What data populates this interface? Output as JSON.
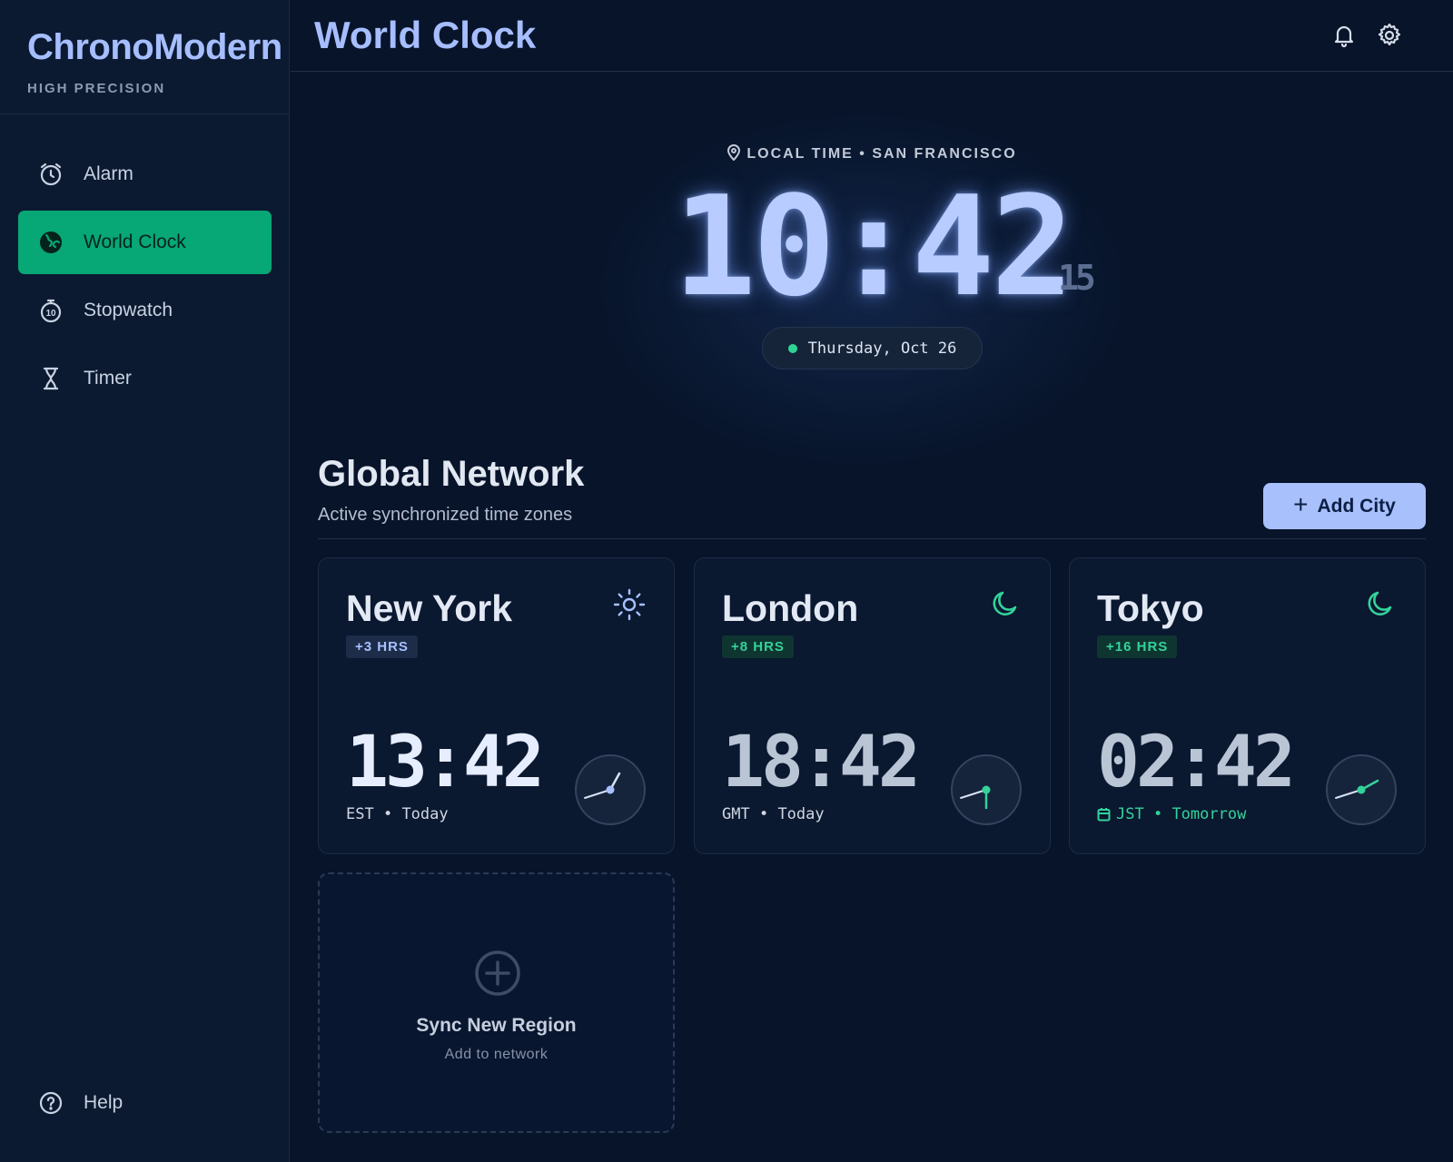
{
  "brand": {
    "title": "ChronoModern",
    "subtitle": "HIGH PRECISION"
  },
  "nav": {
    "items": [
      {
        "label": "Alarm",
        "icon": "alarm-clock-icon"
      },
      {
        "label": "World Clock",
        "icon": "globe-icon",
        "active": true
      },
      {
        "label": "Stopwatch",
        "icon": "stopwatch-icon"
      },
      {
        "label": "Timer",
        "icon": "hourglass-icon"
      }
    ],
    "help": {
      "label": "Help",
      "icon": "help-circle-icon"
    }
  },
  "header": {
    "title": "World Clock",
    "icons": [
      "bell-icon",
      "gear-icon"
    ]
  },
  "local": {
    "label": "LOCAL TIME • SAN FRANCISCO",
    "time": "10:42",
    "seconds": "15",
    "date": "Thursday, Oct 26"
  },
  "network": {
    "title": "Global Network",
    "subtitle": "Active synchronized time zones",
    "add_label": "Add City"
  },
  "cities": [
    {
      "name": "New York",
      "offset": "+3 HRS",
      "time": "13:42",
      "zone": "EST",
      "day": "Today",
      "weather_icon": "sun-icon",
      "accent": "#a8c0ff"
    },
    {
      "name": "London",
      "offset": "+8 HRS",
      "time": "18:42",
      "zone": "GMT",
      "day": "Today",
      "weather_icon": "moon-icon",
      "accent": "#33d39a"
    },
    {
      "name": "Tokyo",
      "offset": "+16 HRS",
      "time": "02:42",
      "zone": "JST",
      "day": "Tomorrow",
      "weather_icon": "moon-icon",
      "accent": "#33d39a"
    }
  ],
  "sync": {
    "title": "Sync New Region",
    "subtitle": "Add to network",
    "icon": "plus-circle-icon"
  },
  "colors": {
    "accent_blue": "#a6beff",
    "accent_green": "#07a776",
    "background": "#07142a"
  }
}
